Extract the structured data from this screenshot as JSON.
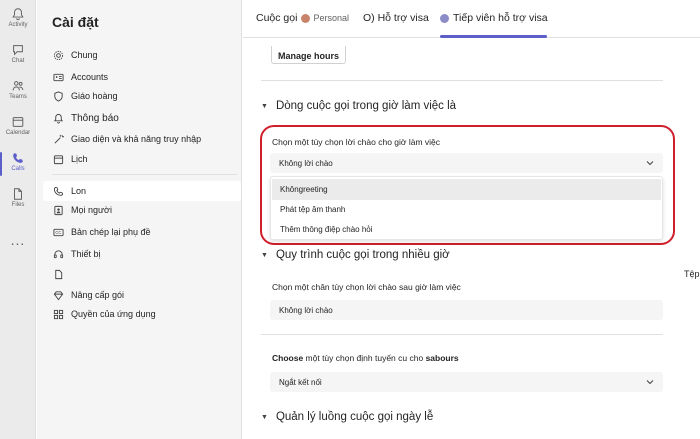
{
  "rail": {
    "items": [
      {
        "label": "Activity",
        "icon": "bell-icon"
      },
      {
        "label": "Chat",
        "icon": "chat-icon"
      },
      {
        "label": "Teams",
        "icon": "teams-icon"
      },
      {
        "label": "Calendar",
        "icon": "calendar-icon"
      },
      {
        "label": "Calls",
        "icon": "phone-icon",
        "active": true
      },
      {
        "label": "Files",
        "icon": "file-icon"
      }
    ],
    "more": "..."
  },
  "sidebar": {
    "title": "Cài đặt",
    "items": [
      {
        "label": "Chung",
        "icon": "gear-icon"
      },
      {
        "label": "Accounts",
        "icon": "id-card-icon"
      },
      {
        "label": "Giáo hoàng",
        "icon": "shield-icon"
      },
      {
        "label": "Thông báo",
        "icon": "bell-icon"
      },
      {
        "label": "Giao diện và khả năng truy nhập",
        "icon": "wand-icon"
      },
      {
        "label": "Lịch",
        "icon": "calendar-icon"
      },
      {
        "label": "Lon",
        "icon": "phone-icon",
        "selected": true
      },
      {
        "label": "Mọi người",
        "icon": "person-icon"
      },
      {
        "label": "Bản chép lại phụ đề",
        "icon": "cc-icon"
      },
      {
        "label": "Thiết bị",
        "icon": "headset-icon"
      },
      {
        "label": "",
        "icon": "document-icon"
      },
      {
        "label": "Nâng cấp gói",
        "icon": "diamond-icon"
      },
      {
        "label": "Quyền của ứng dụng",
        "icon": "apps-icon"
      }
    ]
  },
  "tabs": {
    "calls": "Cuộc gọi",
    "personal": "Personal",
    "support": "O) Hỗ trợ visa",
    "agent": "Tiếp viên hỗ trợ visa"
  },
  "content": {
    "manage_hours_button": "Manage hours",
    "section_business_hours": "Dòng cuộc gọi trong giờ làm việc là",
    "greeting_label": "Chọn một tùy chọn lời chào cho giờ làm việc",
    "greeting_value": "Không lời chào",
    "dropdown_options": [
      {
        "label": "Khôngreeting",
        "hover": true
      },
      {
        "label": "Phát tệp âm thanh"
      },
      {
        "label": "Thêm thông điệp chào hỏi"
      }
    ],
    "section_after_hours": "Quy trình cuộc gọi trong nhiều giờ",
    "after_greeting_label": "Chọn một chân tùy chọn lời chào sau giờ làm việc",
    "after_greeting_value": "Không lời chào",
    "routing_label_prefix": "Choose",
    "routing_label_mid": " một tùy chọn định tuyến cu cho ",
    "routing_label_suffix": "sabours",
    "routing_value": "Ngắt kết nối",
    "section_holidays": "Quản lý luồng cuộc gọi ngày lễ",
    "cut_off_text": "Tệp"
  },
  "colors": {
    "accent": "#5b5fc7",
    "highlight_border": "#d01f2a"
  }
}
